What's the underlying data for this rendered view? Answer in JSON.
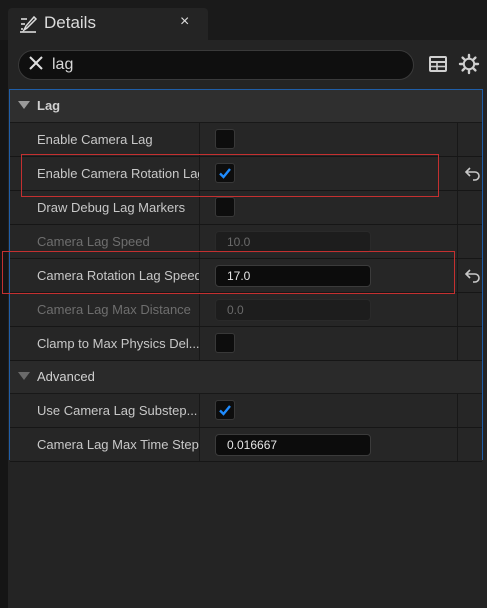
{
  "tab": {
    "title": "Details",
    "close_glyph": "×",
    "icon": "details-pencil-icon"
  },
  "search": {
    "value": "lag",
    "clear_icon": "close-icon"
  },
  "toolbar": {
    "table_icon": "table-view-icon",
    "settings_icon": "gear-icon"
  },
  "categories": {
    "lag": "Lag",
    "advanced": "Advanced"
  },
  "properties": [
    {
      "label": "Enable Camera Lag",
      "type": "checkbox",
      "checked": false,
      "enabled": true,
      "modified": false
    },
    {
      "label": "Enable Camera Rotation Lag",
      "type": "checkbox",
      "checked": true,
      "enabled": true,
      "modified": true
    },
    {
      "label": "Draw Debug Lag Markers",
      "type": "checkbox",
      "checked": false,
      "enabled": true,
      "modified": false
    },
    {
      "label": "Camera Lag Speed",
      "type": "number",
      "value": "10.0",
      "enabled": false,
      "modified": false
    },
    {
      "label": "Camera Rotation Lag Speed",
      "type": "number",
      "value": "17.0",
      "enabled": true,
      "modified": true
    },
    {
      "label": "Camera Lag Max Distance",
      "type": "number",
      "value": "0.0",
      "enabled": false,
      "modified": false
    },
    {
      "label": "Clamp to Max Physics Del...",
      "type": "checkbox",
      "checked": false,
      "enabled": true,
      "modified": false
    }
  ],
  "advanced_properties": [
    {
      "label": "Use Camera Lag Substep...",
      "type": "checkbox",
      "checked": true,
      "enabled": true,
      "modified": false
    },
    {
      "label": "Camera Lag Max Time Step",
      "type": "number",
      "value": "0.016667",
      "enabled": true,
      "modified": false
    }
  ],
  "colors": {
    "accent": "#1f8cff",
    "highlight_box": "#c43030",
    "panel": "#242424",
    "row": "#262626"
  }
}
